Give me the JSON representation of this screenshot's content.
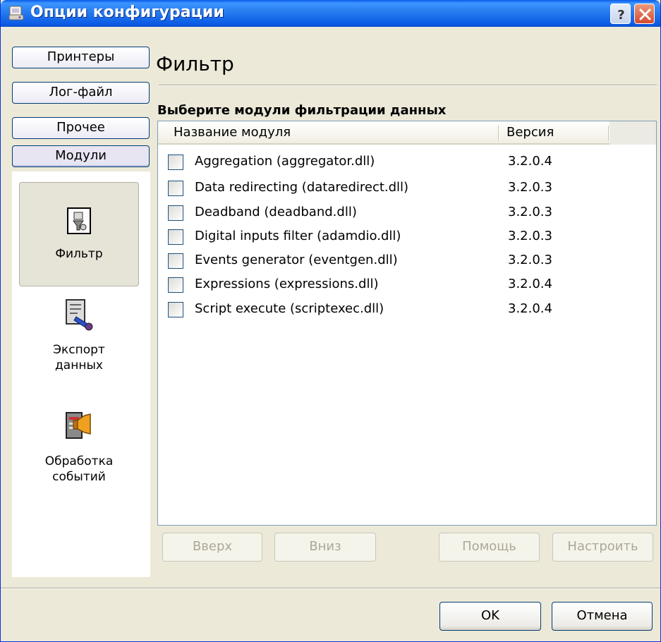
{
  "window": {
    "title": "Опции конфигурации",
    "help_label": "?",
    "close_label": "✕"
  },
  "nav": {
    "buttons": [
      {
        "label": "Принтеры"
      },
      {
        "label": "Лог-файл"
      },
      {
        "label": "Прочее"
      },
      {
        "label": "Модули"
      }
    ],
    "items": [
      {
        "label": "Фильтр",
        "icon": "filter-module-icon",
        "selected": true
      },
      {
        "label_line1": "Экспорт",
        "label_line2": "данных",
        "icon": "data-export-icon"
      },
      {
        "label_line1": "Обработка",
        "label_line2": "событий",
        "icon": "event-processing-icon"
      }
    ]
  },
  "content": {
    "heading": "Фильтр",
    "subheading": "Выберите модули фильтрации данных",
    "columns": {
      "name": "Название модуля",
      "version": "Версия"
    },
    "modules": [
      {
        "name": "Aggregation (aggregator.dll)",
        "version": "3.2.0.4",
        "checked": false
      },
      {
        "name": "Data redirecting (dataredirect.dll)",
        "version": "3.2.0.3",
        "checked": false
      },
      {
        "name": "Deadband (deadband.dll)",
        "version": "3.2.0.3",
        "checked": false
      },
      {
        "name": "Digital inputs filter (adamdio.dll)",
        "version": "3.2.0.3",
        "checked": false
      },
      {
        "name": "Events generator (eventgen.dll)",
        "version": "3.2.0.3",
        "checked": false
      },
      {
        "name": "Expressions (expressions.dll)",
        "version": "3.2.0.4",
        "checked": false
      },
      {
        "name": "Script execute (scriptexec.dll)",
        "version": "3.2.0.4",
        "checked": false
      }
    ],
    "buttons": {
      "up": "Вверх",
      "down": "Вниз",
      "help": "Помощь",
      "configure": "Настроить"
    }
  },
  "footer": {
    "ok": "OK",
    "cancel": "Отмена"
  },
  "colors": {
    "titlebar": "#0c5ce6",
    "face": "#ece9d8",
    "border": "#003c74"
  }
}
